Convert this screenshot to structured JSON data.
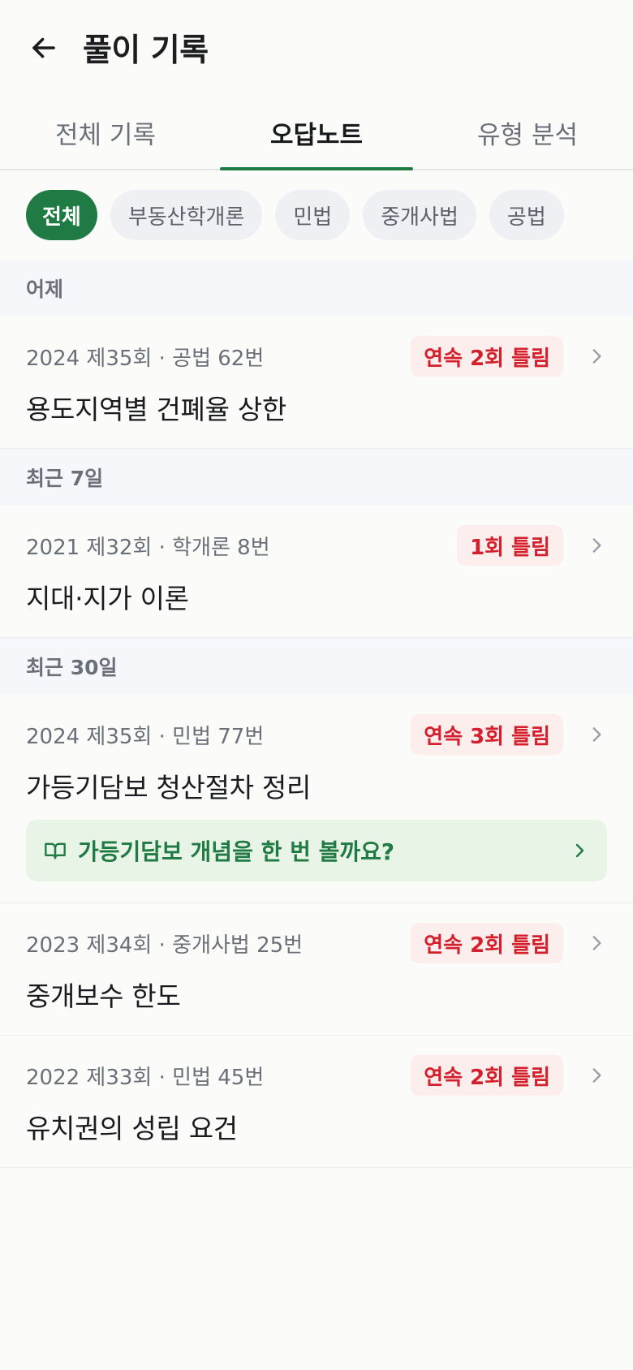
{
  "header": {
    "title": "풀이 기록",
    "back_icon": "arrow-left-icon"
  },
  "tabs": [
    {
      "label": "전체 기록",
      "active": false
    },
    {
      "label": "오답노트",
      "active": true
    },
    {
      "label": "유형 분석",
      "active": false
    }
  ],
  "filters": [
    {
      "label": "전체",
      "active": true
    },
    {
      "label": "부동산학개론",
      "active": false
    },
    {
      "label": "민법",
      "active": false
    },
    {
      "label": "중개사법",
      "active": false
    },
    {
      "label": "공법",
      "active": false
    }
  ],
  "sections": [
    {
      "label": "어제",
      "items": [
        {
          "meta": "2024 제35회 · 공법 62번",
          "badge": "연속 2회 틀림",
          "title": "용도지역별 건폐율 상한"
        }
      ]
    },
    {
      "label": "최근 7일",
      "items": [
        {
          "meta": "2021 제32회 · 학개론 8번",
          "badge": "1회 틀림",
          "title": "지대·지가 이론"
        }
      ]
    },
    {
      "label": "최근 30일",
      "items": [
        {
          "meta": "2024 제35회 · 민법 77번",
          "badge": "연속 3회 틀림",
          "title": "가등기담보 청산절차 정리",
          "concept": "가등기담보 개념을 한 번 볼까요?"
        },
        {
          "meta": "2023 제34회 · 중개사법 25번",
          "badge": "연속 2회 틀림",
          "title": "중개보수 한도"
        },
        {
          "meta": "2022 제33회 · 민법 45번",
          "badge": "연속 2회 틀림",
          "title": "유치권의 성립 요건"
        }
      ]
    }
  ],
  "colors": {
    "accent": "#1f7a43",
    "badge_text": "#d4202c",
    "badge_bg": "#fdeeee",
    "concept_bg": "#e8f4e6"
  }
}
